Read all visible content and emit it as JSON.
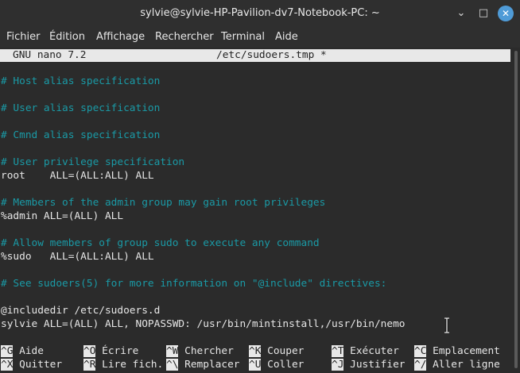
{
  "window": {
    "title": "sylvie@sylvie-HP-Pavilion-dv7-Notebook-PC: ~",
    "minimize_glyph": "⌄",
    "maximize_glyph": "□",
    "close_glyph": "✕"
  },
  "menu": [
    "Fichier",
    "Édition",
    "Affichage",
    "Rechercher",
    "Terminal",
    "Aide"
  ],
  "nano": {
    "version": "GNU nano 7.2",
    "filename": "/etc/sudoers.tmp *"
  },
  "lines": [
    {
      "text": "# Host alias specification",
      "kind": "comment"
    },
    {
      "text": "# User alias specification",
      "kind": "comment"
    },
    {
      "text": "# Cmnd alias specification",
      "kind": "comment"
    },
    {
      "text": "# User privilege specification",
      "kind": "comment"
    },
    {
      "text": "root    ALL=(ALL:ALL) ALL",
      "kind": "text"
    },
    {
      "text": "# Members of the admin group may gain root privileges",
      "kind": "comment"
    },
    {
      "text": "%admin ALL=(ALL) ALL",
      "kind": "text"
    },
    {
      "text": "# Allow members of group sudo to execute any command",
      "kind": "comment"
    },
    {
      "text": "%sudo   ALL=(ALL:ALL) ALL",
      "kind": "text"
    },
    {
      "text": "# See sudoers(5) for more information on \"@include\" directives:",
      "kind": "comment"
    },
    {
      "text": "@includedir /etc/sudoers.d",
      "kind": "text"
    },
    {
      "text": "sylvie ALL=(ALL) ALL, NOPASSWD: /usr/bin/mintinstall,/usr/bin/nemo",
      "kind": "text"
    }
  ],
  "shortcuts": [
    {
      "key": "^G",
      "label": "Aide"
    },
    {
      "key": "^O",
      "label": "Écrire"
    },
    {
      "key": "^W",
      "label": "Chercher"
    },
    {
      "key": "^K",
      "label": "Couper"
    },
    {
      "key": "^T",
      "label": "Exécuter"
    },
    {
      "key": "^C",
      "label": "Emplacement"
    },
    {
      "key": "^X",
      "label": "Quitter"
    },
    {
      "key": "^R",
      "label": "Lire fich."
    },
    {
      "key": "^\\",
      "label": "Remplacer"
    },
    {
      "key": "^U",
      "label": "Coller"
    },
    {
      "key": "^J",
      "label": "Justifier"
    },
    {
      "key": "^/",
      "label": "Aller ligne"
    }
  ]
}
